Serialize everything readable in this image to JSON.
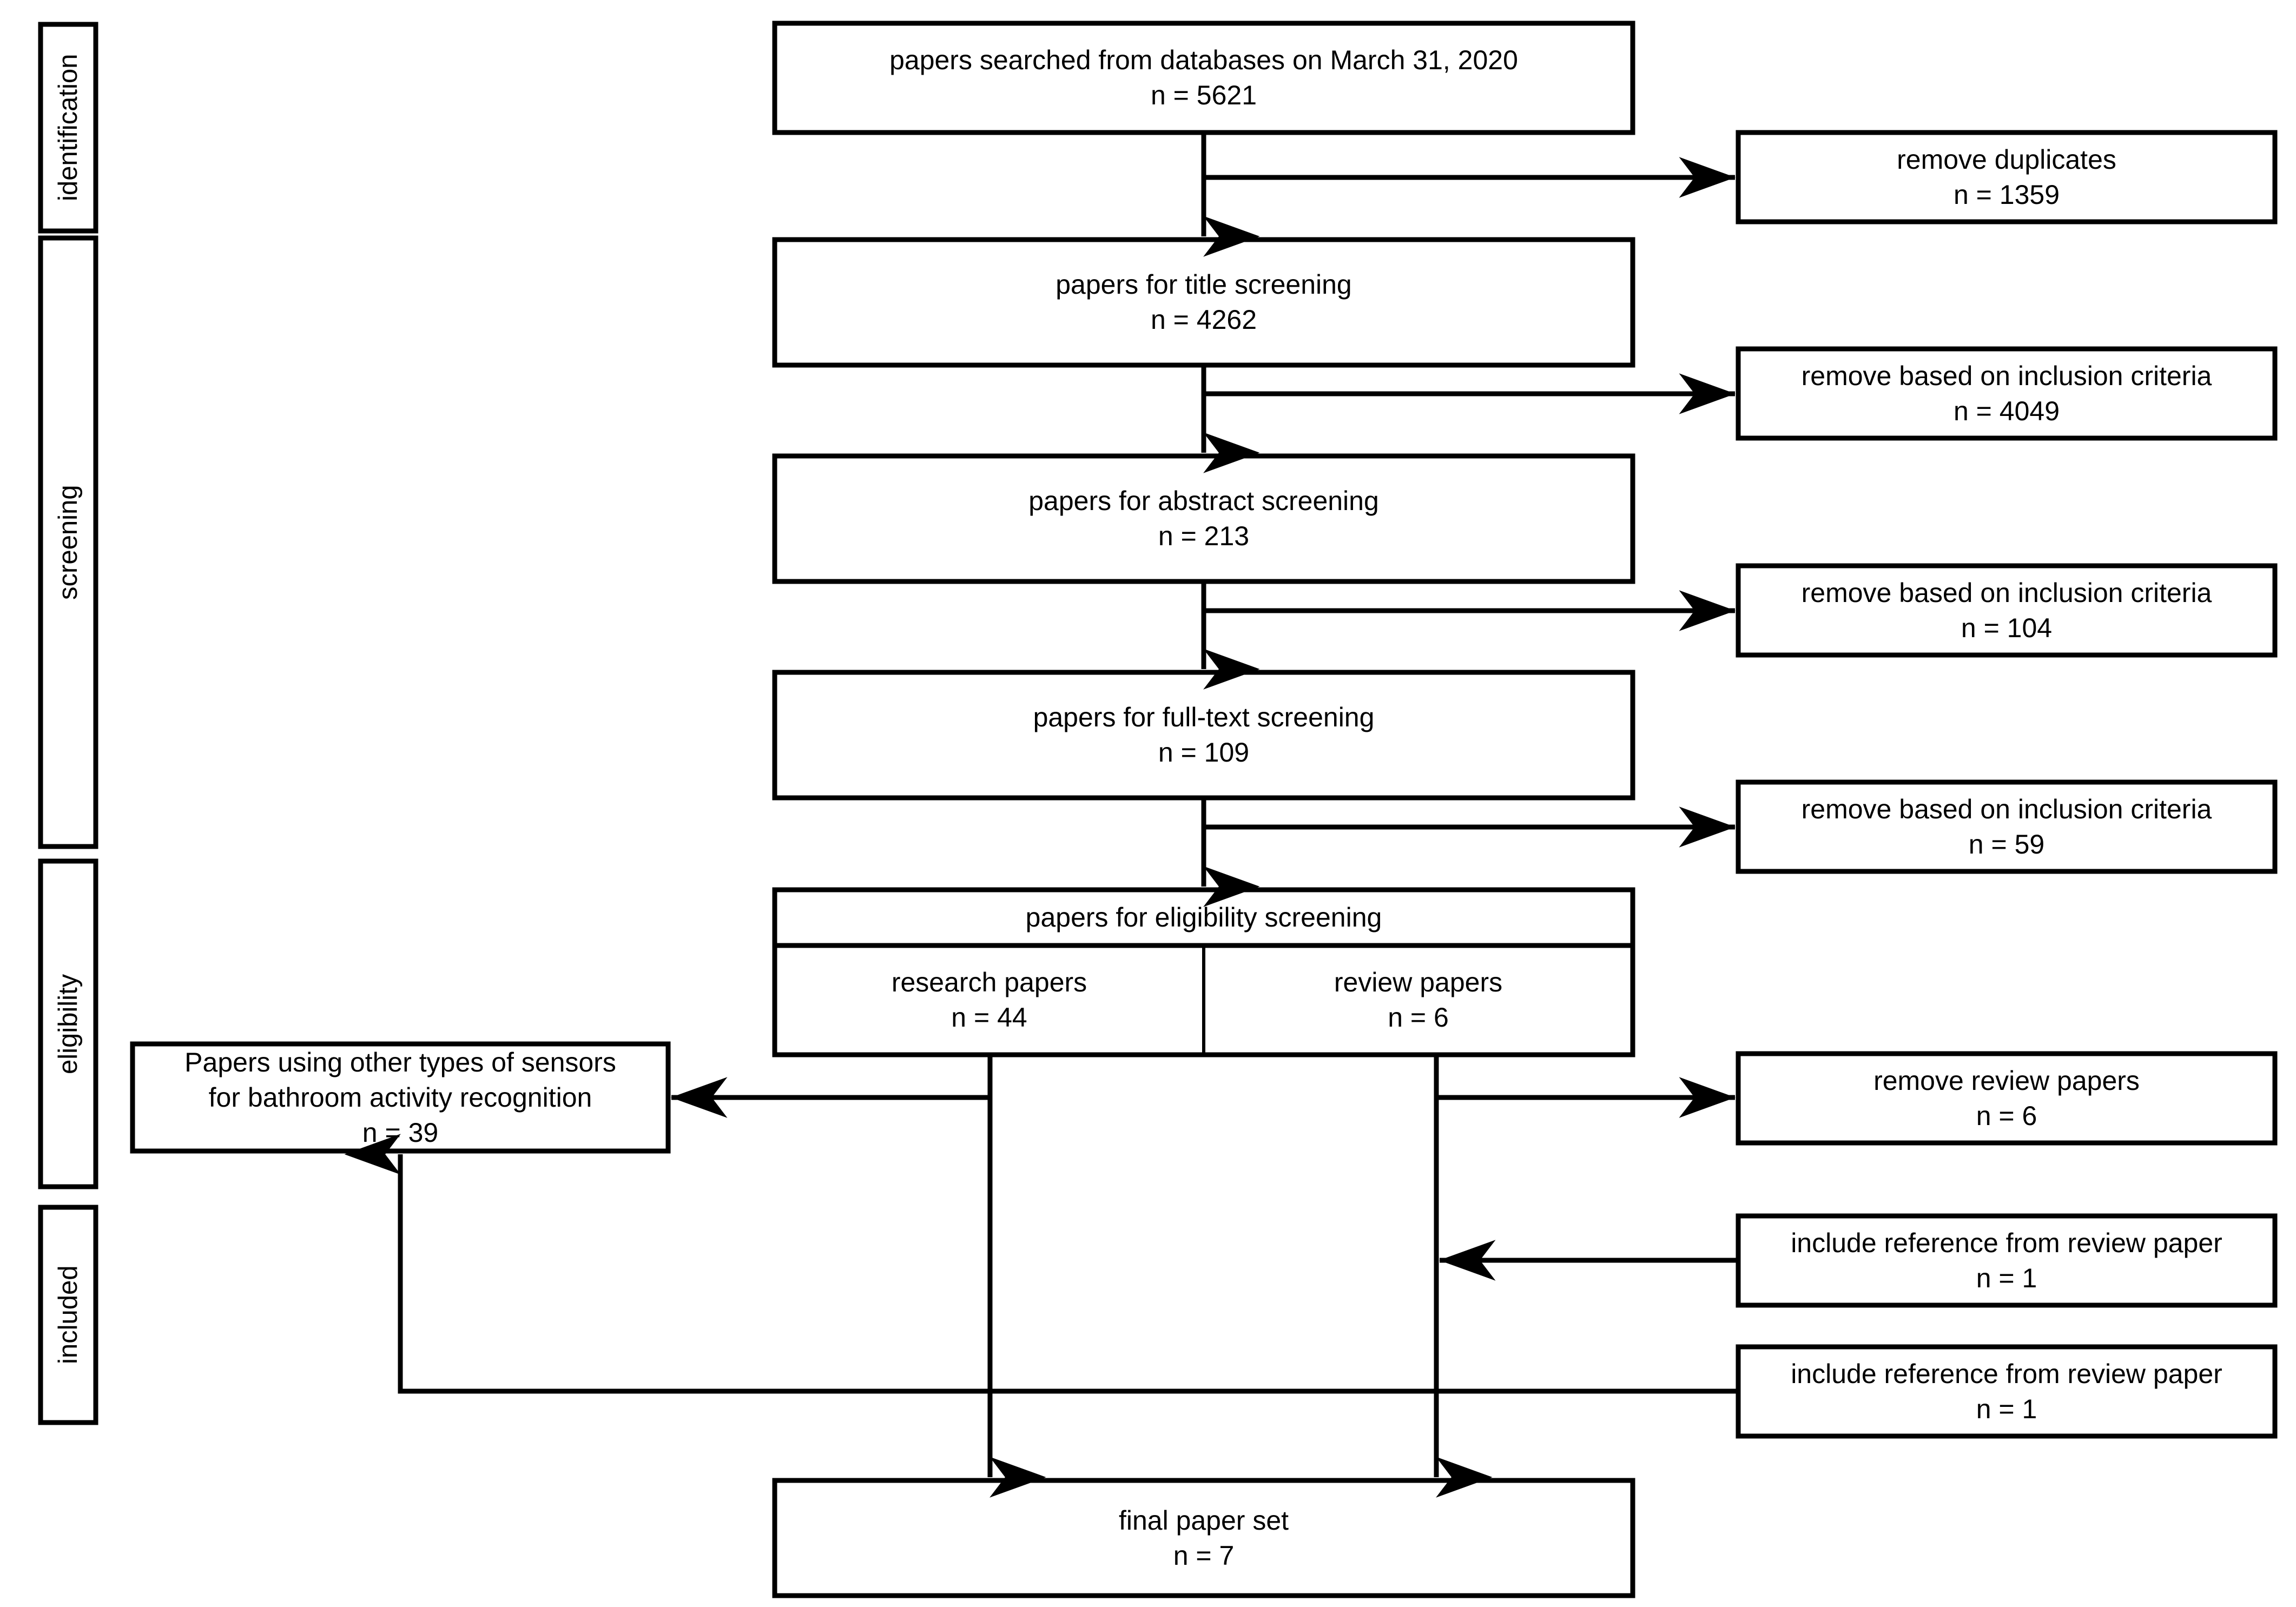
{
  "diagram": {
    "type": "prisma-flow-diagram",
    "stage_labels": [
      {
        "id": "identification",
        "label": "identification"
      },
      {
        "id": "screening",
        "label": "screening"
      },
      {
        "id": "eligibility",
        "label": "eligibility"
      },
      {
        "id": "included",
        "label": "included"
      }
    ],
    "main_boxes": [
      {
        "id": "searched",
        "line1": "papers searched from databases on March 31, 2020",
        "line2": "n = 5621",
        "n": 5621
      },
      {
        "id": "title-screening",
        "line1": "papers for title screening",
        "line2": "n = 4262",
        "n": 4262
      },
      {
        "id": "abstract-screening",
        "line1": "papers for abstract screening",
        "line2": "n = 213",
        "n": 213
      },
      {
        "id": "fulltext-screening",
        "line1": "papers for full-text screening",
        "line2": "n = 109",
        "n": 109
      },
      {
        "id": "final-set",
        "line1": "final paper set",
        "line2": "n = 7",
        "n": 7
      }
    ],
    "eligibility_box": {
      "id": "eligibility-screening",
      "header": "papers for eligibility screening",
      "left_cell": {
        "id": "research-papers",
        "line1": "research papers",
        "line2": "n = 44",
        "n": 44
      },
      "right_cell": {
        "id": "review-papers",
        "line1": "review papers",
        "line2": "n = 6",
        "n": 6
      }
    },
    "side_boxes": [
      {
        "id": "remove-duplicates",
        "side": "right",
        "line1": "remove duplicates",
        "line2": "n = 1359",
        "n": 1359
      },
      {
        "id": "remove-inclusion-1",
        "side": "right",
        "line1": "remove based on inclusion criteria",
        "line2": "n = 4049",
        "n": 4049
      },
      {
        "id": "remove-inclusion-2",
        "side": "right",
        "line1": "remove based on inclusion criteria",
        "line2": "n = 104",
        "n": 104
      },
      {
        "id": "remove-inclusion-3",
        "side": "right",
        "line1": "remove based on inclusion criteria",
        "line2": "n = 59",
        "n": 59
      },
      {
        "id": "remove-review-papers",
        "side": "right",
        "line1": "remove review papers",
        "line2": "n = 6",
        "n": 6
      },
      {
        "id": "include-reference-1",
        "side": "right",
        "line1": "include reference from review paper",
        "line2": "n = 1",
        "n": 1
      },
      {
        "id": "include-reference-2",
        "side": "right",
        "line1": "include reference from review paper",
        "line2": "n = 1",
        "n": 1
      }
    ],
    "left_box": {
      "id": "other-sensors",
      "line1": "Papers using other types of sensors",
      "line2": "for bathroom activity recognition",
      "line3": "n = 39",
      "n": 39
    },
    "colors": {
      "stroke": "#000000",
      "fill": "#ffffff",
      "text": "#000000"
    }
  }
}
